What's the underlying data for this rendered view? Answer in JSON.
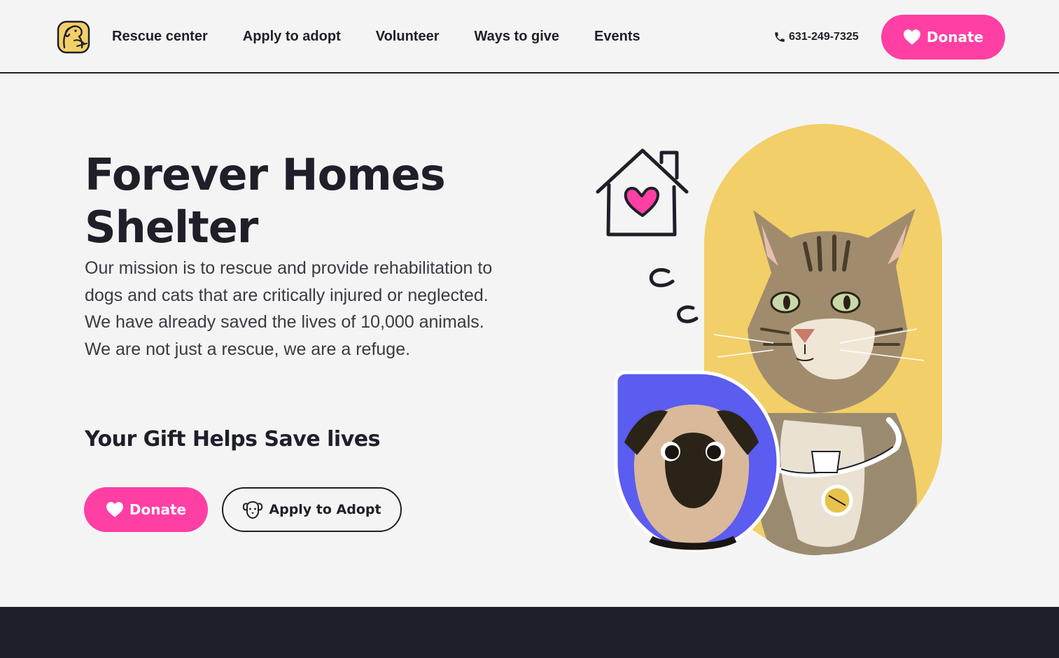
{
  "brand": {
    "logo_icon": "dog-cat-logo-icon",
    "accent_color": "#ff3fa4",
    "yellow_color": "#f2cf68",
    "blue_color": "#5b5cf0",
    "dark_color": "#1f1f29"
  },
  "nav": {
    "items": [
      {
        "label": "Rescue center"
      },
      {
        "label": "Apply to adopt"
      },
      {
        "label": "Volunteer"
      },
      {
        "label": "Ways to give"
      },
      {
        "label": "Events"
      }
    ],
    "phone": "631-249-7325",
    "phone_icon": "phone-icon",
    "donate_label": "Donate"
  },
  "hero": {
    "title": "Forever Homes Shelter",
    "description": "Our mission is to rescue and provide rehabilitation to dogs and cats that are critically injured or neglected. We have already saved the lives of 10,000 animals. We are not just a rescue, we are a refuge.",
    "gift_heading": "Your Gift Helps Save lives",
    "donate_label": "Donate",
    "adopt_label": "Apply to Adopt",
    "donate_icon": "heart-icon",
    "adopt_icon": "dog-face-icon"
  }
}
